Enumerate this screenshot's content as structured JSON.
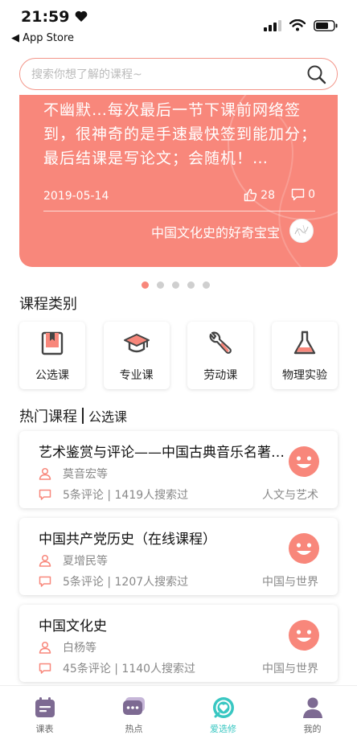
{
  "status_bar": {
    "time": "21:59",
    "back_label": "◀ App Store"
  },
  "search": {
    "placeholder": "搜索你想了解的课程~"
  },
  "banner": {
    "text": "不幽默…每次最后一节下课前网络签到，很神奇的是手速最快签到能加分；最后结课是写论文；会随机！…",
    "date": "2019-05-14",
    "likes": "28",
    "comments": "0",
    "author": "中国文化史的好奇宝宝",
    "page_count": 5,
    "active_page": 0
  },
  "categories": {
    "title": "课程类别",
    "items": [
      {
        "label": "公选课",
        "icon": "bookmark-book-icon"
      },
      {
        "label": "专业课",
        "icon": "graduation-cap-icon"
      },
      {
        "label": "劳动课",
        "icon": "wrench-icon"
      },
      {
        "label": "物理实验",
        "icon": "flask-icon"
      }
    ]
  },
  "hot": {
    "title": "热门课程",
    "subtitle": "公选课",
    "courses": [
      {
        "name": "艺术鉴赏与评论——中国古典音乐名著导读",
        "teacher": "莫音宏等",
        "stats": "5条评论 | 1419人搜索过",
        "category": "人文与艺术"
      },
      {
        "name": "中国共产党历史（在线课程）",
        "teacher": "夏增民等",
        "stats": "5条评论 | 1207人搜索过",
        "category": "中国与世界"
      },
      {
        "name": "中国文化史",
        "teacher": "白杨等",
        "stats": "45条评论 | 1140人搜索过",
        "category": "中国与世界"
      }
    ]
  },
  "tabbar": {
    "items": [
      {
        "label": "课表",
        "icon": "schedule-icon"
      },
      {
        "label": "热点",
        "icon": "chat-bubble-icon"
      },
      {
        "label": "爱选修",
        "icon": "heart-target-icon"
      },
      {
        "label": "我的",
        "icon": "person-icon"
      }
    ],
    "active_index": 2
  },
  "colors": {
    "accent": "#f8877b",
    "active_tab": "#39c7c2",
    "text": "#222222",
    "muted": "#888888"
  }
}
